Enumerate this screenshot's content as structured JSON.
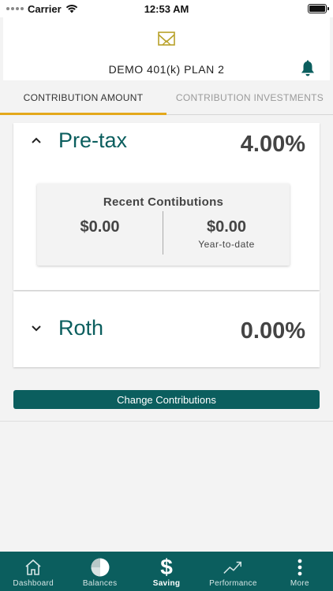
{
  "status_bar": {
    "carrier": "Carrier",
    "time": "12:53 AM"
  },
  "header": {
    "plan_title": "DEMO 401(k) PLAN 2",
    "logo_color": "#b8a12a",
    "bell_color": "#0b5e5e"
  },
  "tabs": [
    {
      "label": "CONTRIBUTION AMOUNT",
      "active": true
    },
    {
      "label": "CONTRIBUTION INVESTMENTS",
      "active": false
    }
  ],
  "pretax": {
    "label": "Pre-tax",
    "percent": "4.00%",
    "expanded": true,
    "recent": {
      "title": "Recent Contibutions",
      "left_value": "$0.00",
      "right_value": "$0.00",
      "right_label": "Year-to-date"
    }
  },
  "roth": {
    "label": "Roth",
    "percent": "0.00%",
    "expanded": false
  },
  "change_button": "Change Contributions",
  "nav": [
    {
      "label": "Dashboard",
      "icon": "home-icon"
    },
    {
      "label": "Balances",
      "icon": "pie-chart-icon"
    },
    {
      "label": "Saving",
      "icon": "dollar-icon",
      "active": true
    },
    {
      "label": "Performance",
      "icon": "trend-up-icon"
    },
    {
      "label": "More",
      "icon": "more-vertical-icon"
    }
  ],
  "colors": {
    "primary": "#0b5e5e",
    "accent": "#e4a81b",
    "background": "#f3f3f3"
  }
}
